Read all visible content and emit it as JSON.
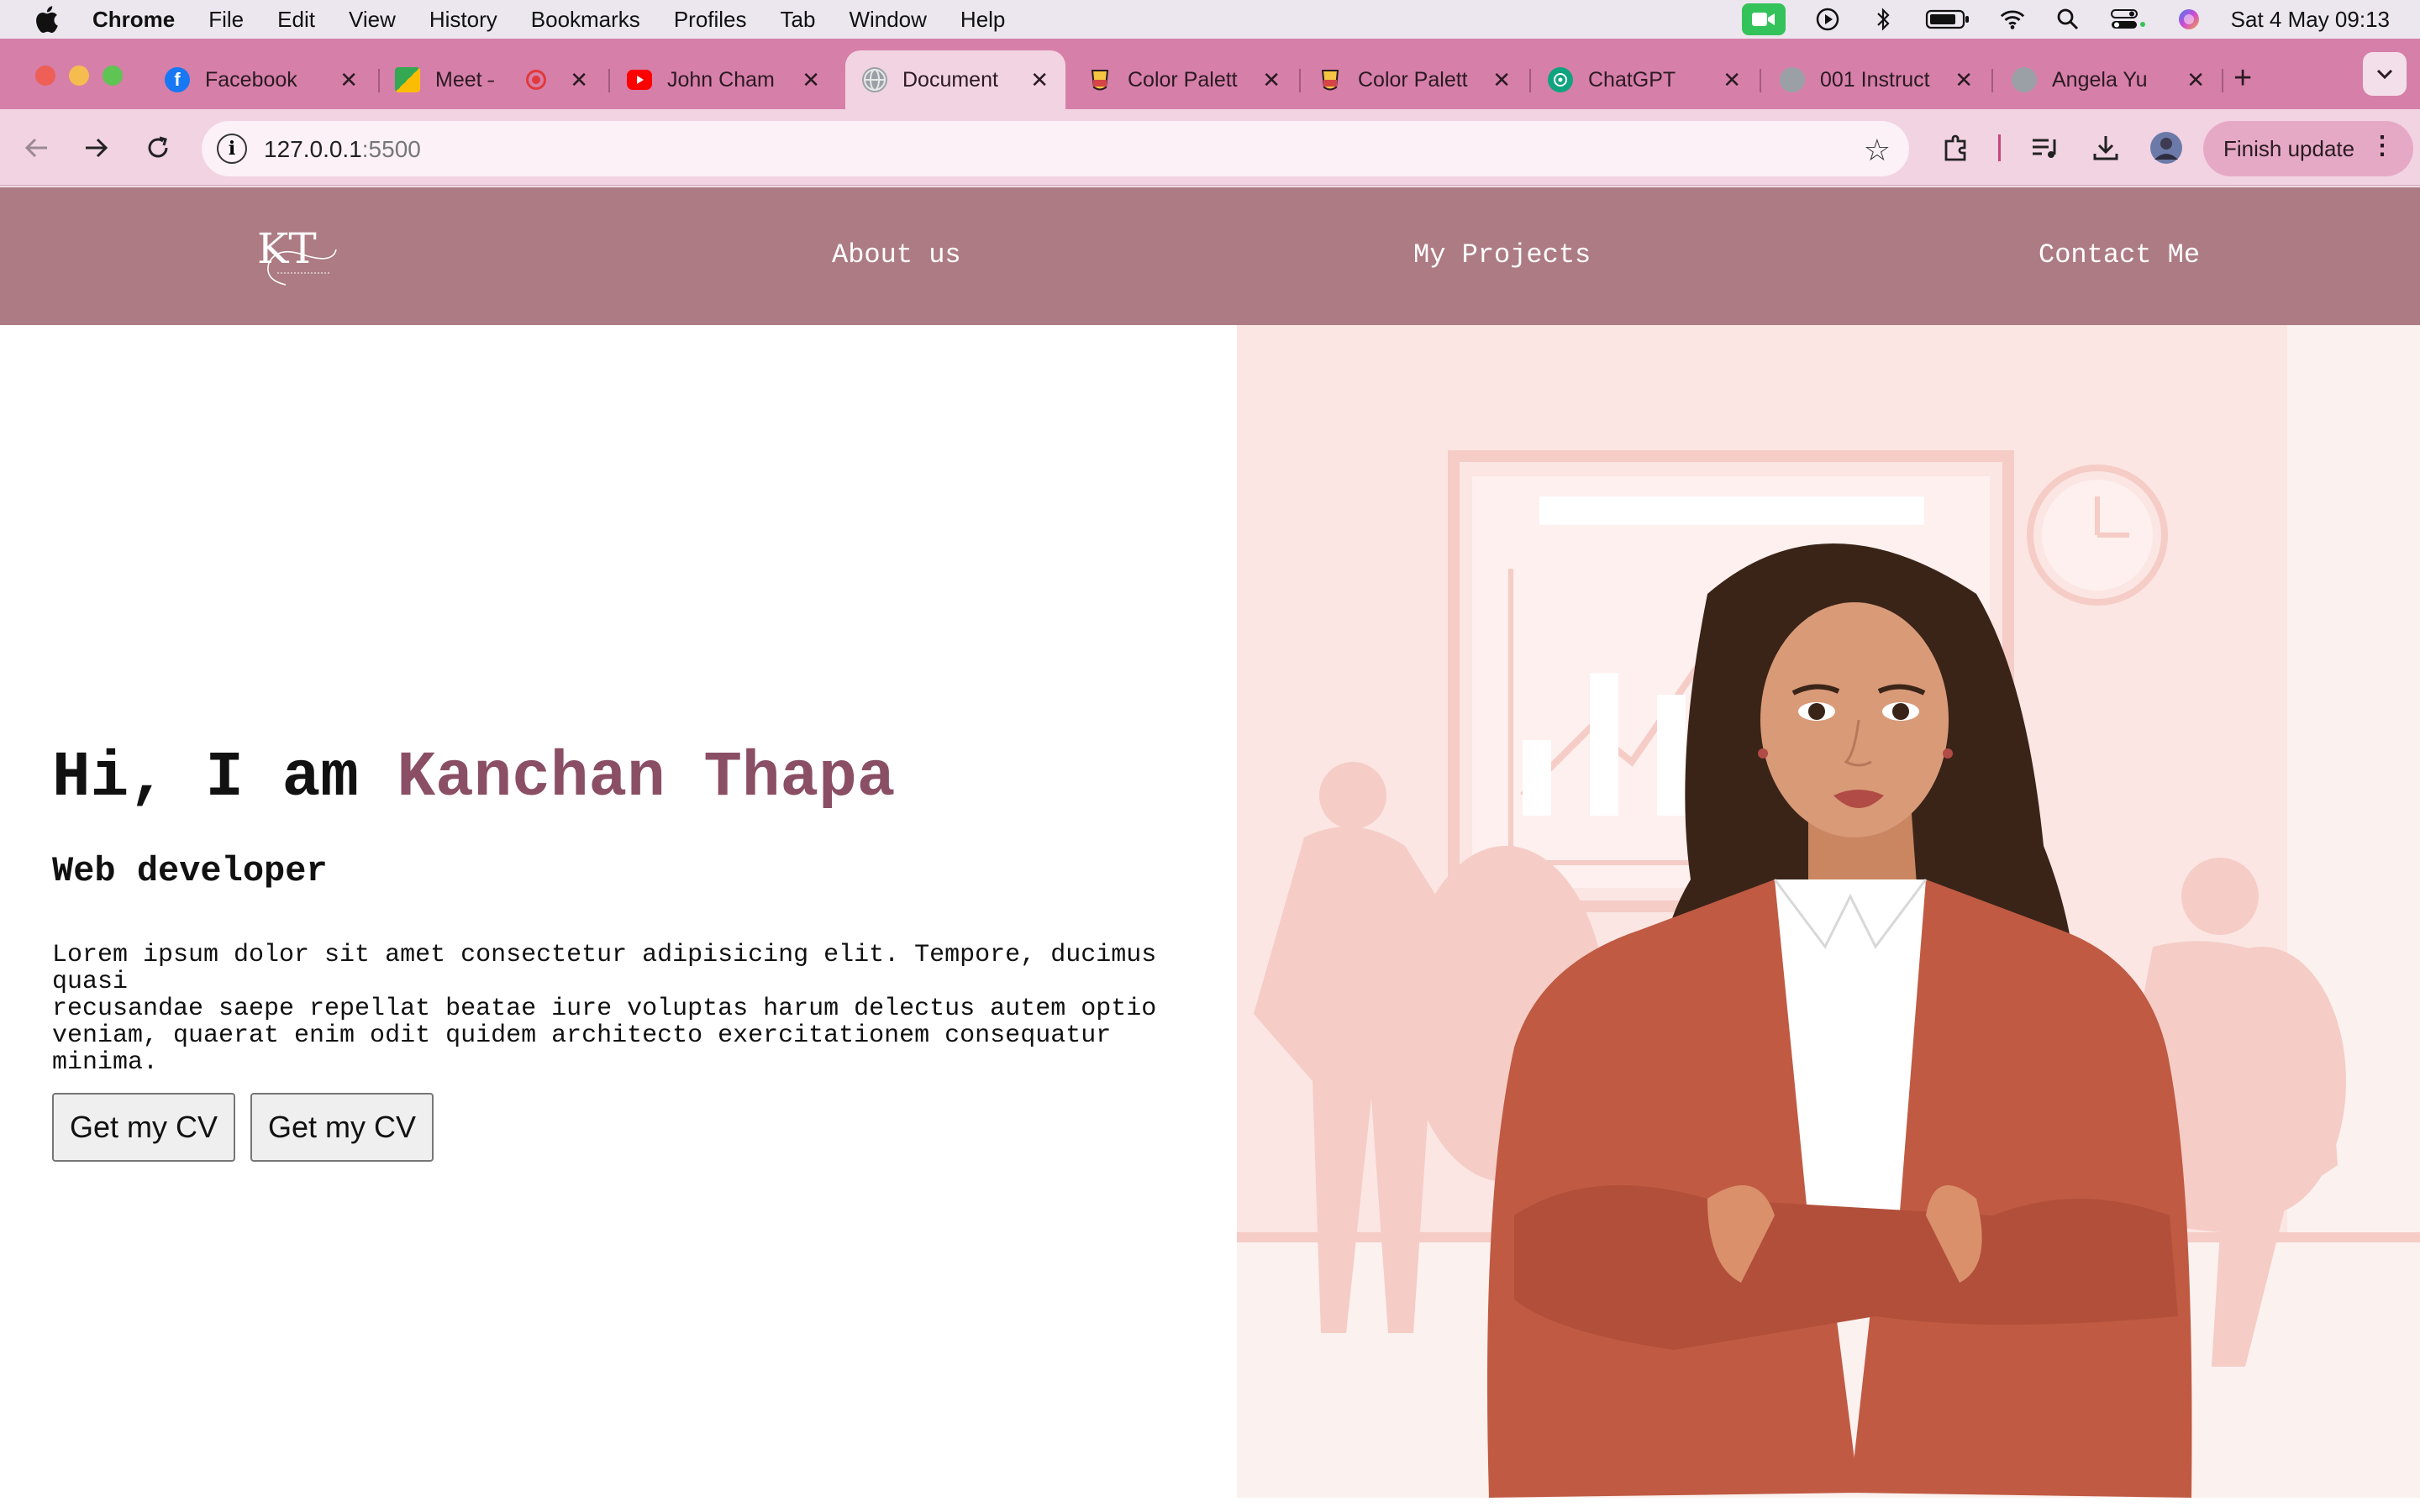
{
  "menubar": {
    "app": "Chrome",
    "items": [
      "File",
      "Edit",
      "View",
      "History",
      "Bookmarks",
      "Profiles",
      "Tab",
      "Window",
      "Help"
    ],
    "datetime": "Sat 4 May  09:13"
  },
  "tabs": [
    {
      "title": "Facebook",
      "favicon": "facebook-icon",
      "color": "#1877f2"
    },
    {
      "title": "Meet – c",
      "favicon": "meet-icon",
      "color": "#1a73e8"
    },
    {
      "title": "John Cham",
      "favicon": "youtube-icon",
      "color": "#ff0000"
    },
    {
      "title": "Document",
      "favicon": "globe-icon",
      "color": "#9aa0a6",
      "active": true
    },
    {
      "title": "Color Palett",
      "favicon": "palette-icon",
      "color": "#e8a100"
    },
    {
      "title": "Color Palett",
      "favicon": "palette-icon",
      "color": "#e8a100"
    },
    {
      "title": "ChatGPT",
      "favicon": "chatgpt-icon",
      "color": "#10a37f"
    },
    {
      "title": "001 Instruct",
      "favicon": "globe-icon",
      "color": "#9aa0a6"
    },
    {
      "title": "Angela Yu",
      "favicon": "globe-icon",
      "color": "#9aa0a6"
    }
  ],
  "toolbar": {
    "url_host": "127.0.0.1",
    "url_port": ":5500",
    "finish_update": "Finish update"
  },
  "site": {
    "logo_text": "KT",
    "nav": {
      "about": "About us",
      "projects": "My Projects",
      "contact": "Contact Me"
    },
    "hero": {
      "greeting": "Hi, I am ",
      "name": "Kanchan Thapa",
      "role": "Web developer",
      "text_line1": "Lorem ipsum dolor sit amet consectetur adipisicing elit. Tempore, ducimus quasi",
      "text_line2": "recusandae saepe repellat beatae iure voluptas harum delectus autem optio",
      "text_line3": "veniam, quaerat enim odit quidem architecto exercitationem consequatur minima.",
      "button1": "Get my CV",
      "button2": "Get my CV"
    }
  },
  "colors": {
    "nav_bg": "#ad7b83",
    "accent_name": "#8a4f64",
    "tabstrip": "#d67fa9",
    "toolbar": "#f2d3e2",
    "illustration_bg": "#fbe6e3"
  }
}
